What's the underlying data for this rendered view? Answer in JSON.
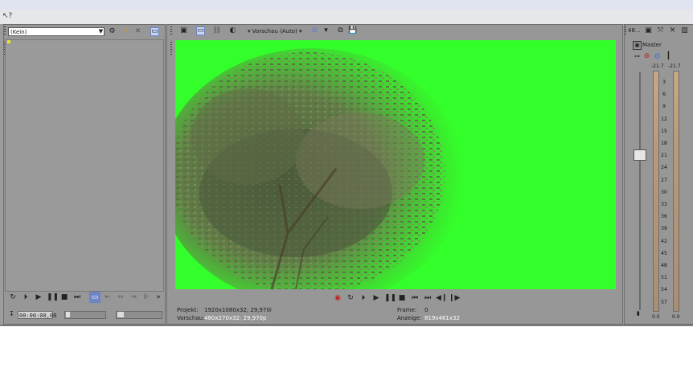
{
  "window": {
    "help_icon": "question-mark-icon"
  },
  "left_panel": {
    "media_select_value": "(Kein)",
    "timecode": "00:00:00,00",
    "transport_icons": [
      "loop-icon",
      "play-from-start-icon",
      "play-icon",
      "pause-icon",
      "stop-icon",
      "go-to-end-icon"
    ]
  },
  "preview": {
    "mode_label": "Vorschau (Auto)",
    "info": {
      "project_label": "Projekt:",
      "project_value": "1920x1080x32; 29,970i",
      "preview_label": "Vorschau:",
      "preview_value": "480x270x32; 29,970p",
      "frame_label": "Frame:",
      "frame_value": "0",
      "display_label": "Anzeige:",
      "display_value": "819x461x32"
    },
    "background_color": "#33ff2a"
  },
  "master": {
    "title_prefix": "48...",
    "label": "Master",
    "peak_left": "-21.7",
    "peak_right": "-21.7",
    "bottom_left": "0.0",
    "bottom_right": "0.0",
    "scale": [
      "3",
      "6",
      "9",
      "12",
      "15",
      "18",
      "21",
      "24",
      "27",
      "30",
      "33",
      "36",
      "39",
      "42",
      "45",
      "48",
      "51",
      "54",
      "57"
    ]
  }
}
